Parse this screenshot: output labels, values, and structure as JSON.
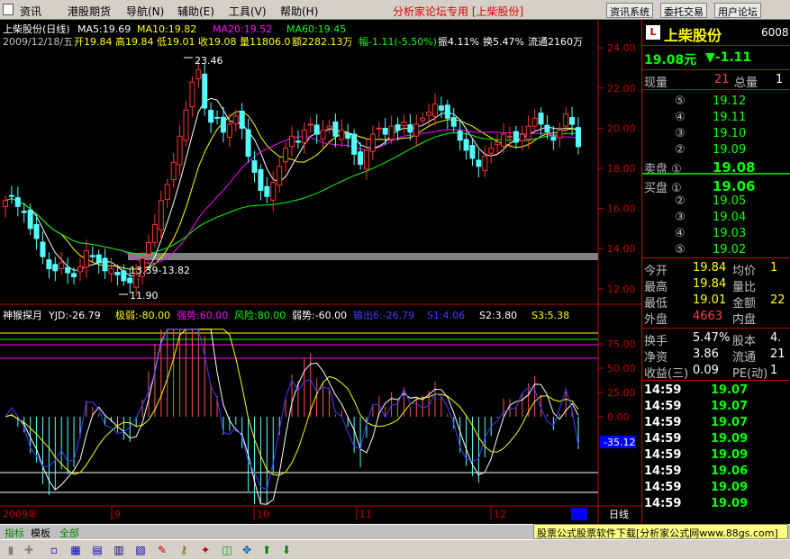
{
  "menu": {
    "items": [
      "资讯",
      "港股期货",
      "导航(N)",
      "辅助(E)",
      "工具(V)",
      "帮助(H)"
    ],
    "app_title": "分析家论坛专用 [上柴股份]",
    "buttons": [
      "资讯系统",
      "委托交易",
      "用户论坛"
    ]
  },
  "kline": {
    "title": "上柴股份(日线)",
    "ma5": "MA5:19.69",
    "ma10": "MA10:19.82",
    "ma20": "MA20:19.52",
    "ma60": "MA60:19.45",
    "info_date": "2009/12/18/五",
    "info_open": "开19.84",
    "info_high": "高19.84",
    "info_low": "低19.01",
    "info_close": "收19.08",
    "info_vol": "量11806.0",
    "info_amt": "额2282.13万",
    "info_chg": "幅-1.11(-5.50%)",
    "info_swing": "振4.11%",
    "info_turn": "换5.47%",
    "info_float": "流通2160万",
    "high_label": "23.46",
    "low_label": "11.90",
    "range_label": "13.39-13.82",
    "y_ticks": [
      "24.00",
      "22.00",
      "20.00",
      "18.00",
      "16.00",
      "14.00",
      "12.00"
    ]
  },
  "indicator": {
    "name": "神猴探月",
    "yjd": "YJD:-26.79",
    "weak": "极弱:-80.00",
    "strong": "强势:60.00",
    "risk": "风险:80.00",
    "weak2": "弱势:-60.00",
    "out6": "输出6:-26.79",
    "s1": "S1:4.06",
    "s2": "S2:3.80",
    "s3": "S3:5.38",
    "y_ticks": [
      "75.00",
      "50.00",
      "25.00",
      "0.00"
    ],
    "current_value": "-35.12"
  },
  "x_axis": {
    "labels": [
      "2009年",
      "9",
      "10",
      "11",
      "12"
    ],
    "period": "日线"
  },
  "quote": {
    "name": "上柴股份",
    "code": "6008",
    "price": "19.08元",
    "change": "▼-1.11",
    "now_label": "现量",
    "now_val": "21",
    "total_label": "总量",
    "total_val": "1",
    "sell": [
      {
        "label": "⑤",
        "price": "19.12"
      },
      {
        "label": "④",
        "price": "19.11"
      },
      {
        "label": "③",
        "price": "19.10"
      },
      {
        "label": "②",
        "price": "19.09"
      },
      {
        "label": "卖盘 ①",
        "price": "19.08"
      }
    ],
    "buy": [
      {
        "label": "买盘 ①",
        "price": "19.06"
      },
      {
        "label": "②",
        "price": "19.05"
      },
      {
        "label": "③",
        "price": "19.04"
      },
      {
        "label": "④",
        "price": "19.03"
      },
      {
        "label": "⑤",
        "price": "19.02"
      }
    ],
    "stats": [
      {
        "l1": "今开",
        "v1": "19.84",
        "l2": "均价",
        "v2": "1"
      },
      {
        "l1": "最高",
        "v1": "19.84",
        "l2": "量比",
        "v2": ""
      },
      {
        "l1": "最低",
        "v1": "19.01",
        "l2": "金额",
        "v2": "22"
      },
      {
        "l1": "外盘",
        "v1": "4663",
        "l2": "内盘",
        "v2": ""
      }
    ],
    "stats2": [
      {
        "l1": "换手",
        "v1": "5.47%",
        "l2": "股本",
        "v2": "4."
      },
      {
        "l1": "净资",
        "v1": "3.86",
        "l2": "流通",
        "v2": "21"
      },
      {
        "l1": "收益(三)",
        "v1": "0.09",
        "l2": "PE(动)",
        "v2": "1"
      }
    ],
    "ticks": [
      {
        "t": "14:59",
        "p": "19.07"
      },
      {
        "t": "14:59",
        "p": "19.07"
      },
      {
        "t": "14:59",
        "p": "19.07"
      },
      {
        "t": "14:59",
        "p": "19.09"
      },
      {
        "t": "14:59",
        "p": "19.09"
      },
      {
        "t": "14:59",
        "p": "19.06"
      },
      {
        "t": "14:59",
        "p": "19.09"
      },
      {
        "t": "14:59",
        "p": "19.09"
      }
    ]
  },
  "bottom": {
    "tabs": [
      "指标",
      "模板",
      "全部"
    ],
    "ad": "股票公式股票软件下载[分析家公式网www.88gs.com]"
  },
  "chart_data": {
    "type": "candlestick",
    "ylim": [
      11.5,
      24.5
    ],
    "closes": [
      16.4,
      16.6,
      16.1,
      15.8,
      15.0,
      14.5,
      13.6,
      13.0,
      12.9,
      13.3,
      12.8,
      12.6,
      13.1,
      13.9,
      13.6,
      13.3,
      12.9,
      13.0,
      12.7,
      12.4,
      12.3,
      12.7,
      13.5,
      14.3,
      15.2,
      16.4,
      17.2,
      18.3,
      19.6,
      20.9,
      22.3,
      22.9,
      21.0,
      20.3,
      20.5,
      19.8,
      20.2,
      20.6,
      20.0,
      18.6,
      17.8,
      16.9,
      16.6,
      17.3,
      18.1,
      19.0,
      19.6,
      19.3,
      19.9,
      20.2,
      19.7,
      19.9,
      20.1,
      19.6,
      19.9,
      19.5,
      18.7,
      18.2,
      18.9,
      19.7,
      20.0,
      19.7,
      20.1,
      19.9,
      20.3,
      19.8,
      20.2,
      20.5,
      20.8,
      21.2,
      20.9,
      20.5,
      20.1,
      19.4,
      18.9,
      18.5,
      18.1,
      18.6,
      19.0,
      19.3,
      19.7,
      19.6,
      19.3,
      19.7,
      20.1,
      20.5,
      20.2,
      19.8,
      19.4,
      19.9,
      20.7,
      20.19,
      19.08
    ],
    "ma_series": [
      "MA5",
      "MA10",
      "MA20",
      "MA60"
    ]
  }
}
